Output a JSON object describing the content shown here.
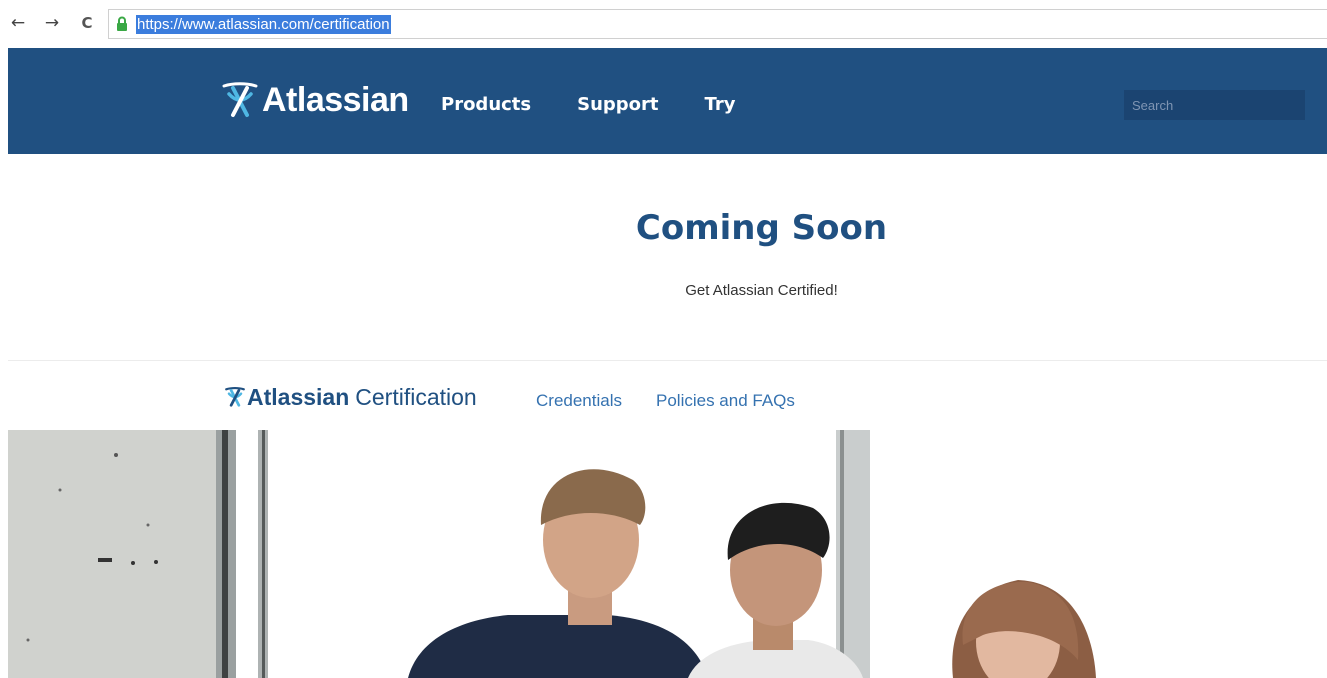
{
  "browser": {
    "back_glyph": "←",
    "forward_glyph": "→",
    "reload_glyph": "C",
    "url": "https://www.atlassian.com/certification"
  },
  "header": {
    "logo_text": "Atlassian",
    "nav": [
      "Products",
      "Support",
      "Try"
    ],
    "search_placeholder": "Search"
  },
  "hero": {
    "title": "Coming Soon",
    "subtitle": "Get Atlassian Certified!"
  },
  "subnav": {
    "logo_bold": "Atlassian",
    "logo_light": "Certification",
    "links": [
      "Credentials",
      "Policies and FAQs"
    ]
  },
  "colors": {
    "brand_blue": "#205081",
    "link_blue": "#3572b0",
    "url_highlight": "#3b7ddd"
  },
  "icons": [
    "back-arrow-icon",
    "forward-arrow-icon",
    "reload-icon",
    "lock-icon",
    "atlassian-logo-icon"
  ]
}
